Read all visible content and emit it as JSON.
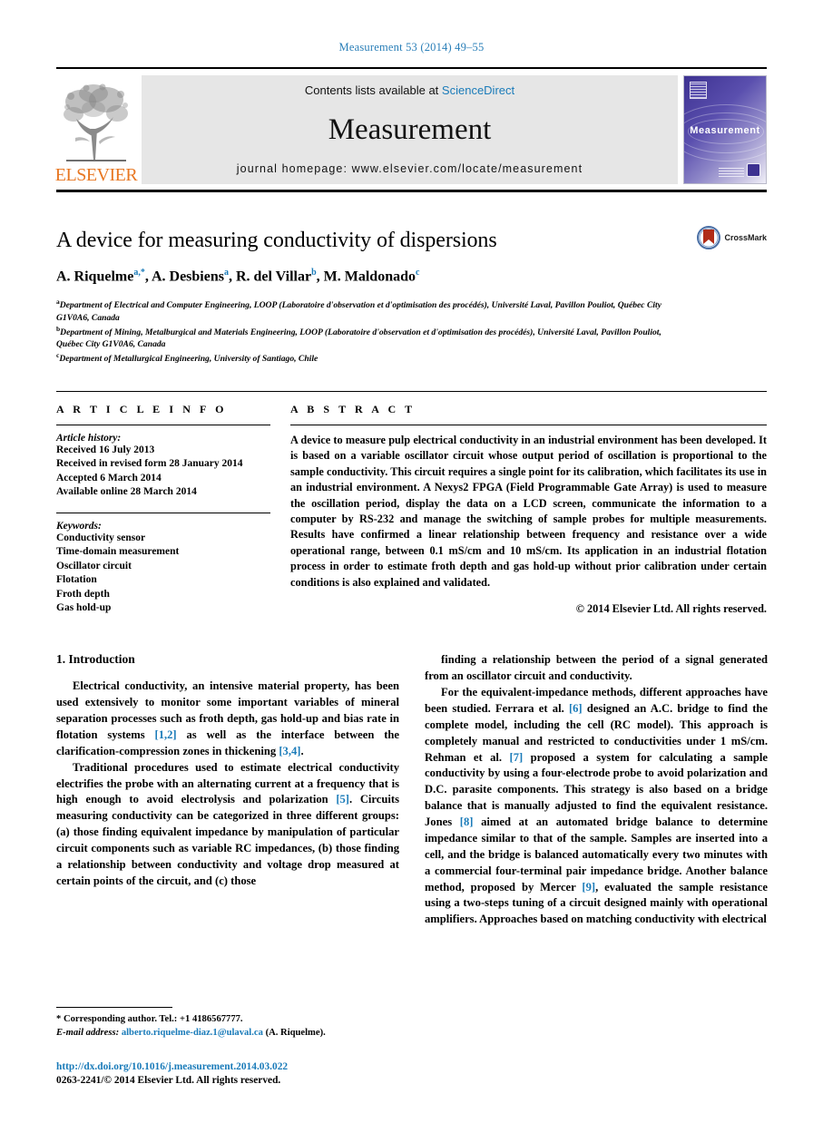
{
  "running_head": "Measurement 53 (2014) 49–55",
  "banner": {
    "publisher_name": "ELSEVIER",
    "contents_prefix": "Contents lists available at",
    "contents_link": "ScienceDirect",
    "journal_title": "Measurement",
    "homepage": "journal homepage: www.elsevier.com/locate/measurement",
    "cover_title": "Measurement"
  },
  "article": {
    "title": "A device for measuring conductivity of dispersions",
    "crossmark_label": "CrossMark",
    "authors": [
      {
        "name": "A. Riquelme",
        "marks": "a,*",
        "sep": ", "
      },
      {
        "name": "A. Desbiens",
        "marks": "a",
        "sep": ", "
      },
      {
        "name": "R. del Villar",
        "marks": "b",
        "sep": ", "
      },
      {
        "name": "M. Maldonado",
        "marks": "c",
        "sep": ""
      }
    ],
    "affiliations": [
      {
        "mark": "a",
        "text": "Department of Electrical and Computer Engineering, LOOP (Laboratoire d'observation et d'optimisation des procédés), Université Laval, Pavillon Pouliot, Québec City G1V0A6, Canada"
      },
      {
        "mark": "b",
        "text": "Department of Mining, Metalburgical and Materials Engineering, LOOP (Laboratoire d'observation et d'optimisation des procédés), Université Laval, Pavillon Pouliot, Québec City G1V0A6, Canada"
      },
      {
        "mark": "c",
        "text": "Department of Metallurgical Engineering, University of Santiago, Chile"
      }
    ]
  },
  "article_info": {
    "heading": "A R T I C L E   I N F O",
    "history_label": "Article history:",
    "history": [
      "Received 16 July 2013",
      "Received in revised form 28 January 2014",
      "Accepted 6 March 2014",
      "Available online 28 March 2014"
    ],
    "keywords_label": "Keywords:",
    "keywords": [
      "Conductivity sensor",
      "Time-domain measurement",
      "Oscillator circuit",
      "Flotation",
      "Froth depth",
      "Gas hold-up"
    ]
  },
  "abstract": {
    "heading": "A B S T R A C T",
    "text": "A device to measure pulp electrical conductivity in an industrial environment has been developed. It is based on a variable oscillator circuit whose output period of oscillation is proportional to the sample conductivity. This circuit requires a single point for its calibration, which facilitates its use in an industrial environment. A Nexys2 FPGA (Field Programmable Gate Array) is used to measure the oscillation period, display the data on a LCD screen, communicate the information to a computer by RS-232 and manage the switching of sample probes for multiple measurements. Results have confirmed a linear relationship between frequency and resistance over a wide operational range, between 0.1 mS/cm and 10 mS/cm. Its application in an industrial flotation process in order to estimate froth depth and gas hold-up without prior calibration under certain conditions is also explained and validated.",
    "copyright": "© 2014 Elsevier Ltd. All rights reserved."
  },
  "body": {
    "section_heading": "1. Introduction",
    "left_paragraphs": [
      "Electrical conductivity, an intensive material property, has been used extensively to monitor some important variables of mineral separation processes such as froth depth, gas hold-up and bias rate in flotation systems [1,2] as well as the interface between the clarification-compression zones in thickening [3,4].",
      "Traditional procedures used to estimate electrical conductivity electrifies the probe with an alternating current at a frequency that is high enough to avoid electrolysis and polarization [5]. Circuits measuring conductivity can be categorized in three different groups: (a) those finding equivalent impedance by manipulation of particular circuit components such as variable RC impedances, (b) those finding a relationship between conductivity and voltage drop measured at certain points of the circuit, and (c) those"
    ],
    "right_paragraphs": [
      "finding a relationship between the period of a signal generated from an oscillator circuit and conductivity.",
      "For the equivalent-impedance methods, different approaches have been studied. Ferrara et al. [6] designed an A.C. bridge to find the complete model, including the cell (RC model). This approach is completely manual and restricted to conductivities under 1 mS/cm. Rehman et al. [7] proposed a system for calculating a sample conductivity by using a four-electrode probe to avoid polarization and D.C. parasite components. This strategy is also based on a bridge balance that is manually adjusted to find the equivalent resistance. Jones [8] aimed at an automated bridge balance to determine impedance similar to that of the sample. Samples are inserted into a cell, and the bridge is balanced automatically every two minutes with a commercial four-terminal pair impedance bridge. Another balance method, proposed by Mercer [9], evaluated the sample resistance using a two-steps tuning of a circuit designed mainly with operational amplifiers. Approaches based on matching conductivity with electrical"
    ]
  },
  "footnotes": {
    "corresponding": "* Corresponding author. Tel.: +1 4186567777.",
    "email_label": "E-mail address:",
    "email": "alberto.riquelme-diaz.1@ulaval.ca",
    "email_suffix": "(A. Riquelme)."
  },
  "imprint": {
    "doi": "http://dx.doi.org/10.1016/j.measurement.2014.03.022",
    "issn_line": "0263-2241/© 2014 Elsevier Ltd. All rights reserved."
  },
  "colors": {
    "link": "#1a7bb9",
    "running_head": "#2a7fb8",
    "elsevier_orange": "#E87722",
    "banner_gray": "#e6e6e6",
    "cover_purple": "#3d3191",
    "crossmark_red": "#b02b17"
  }
}
